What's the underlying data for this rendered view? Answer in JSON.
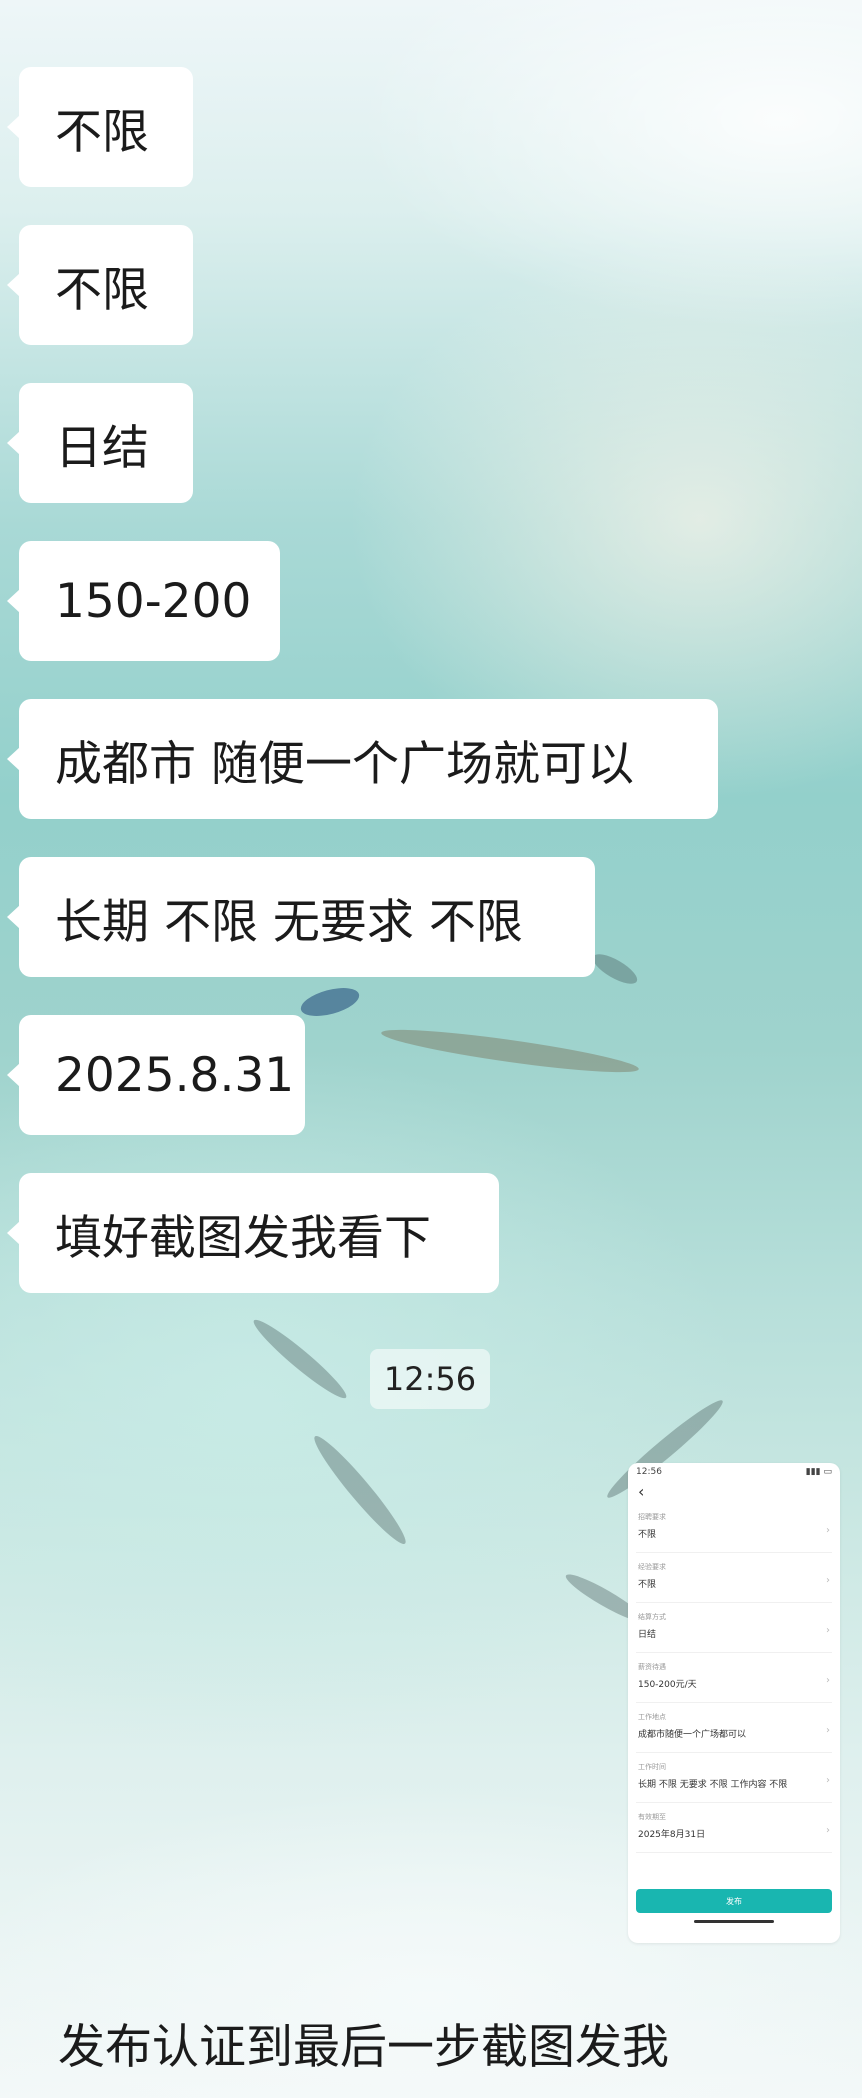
{
  "messages": [
    "不限",
    "不限",
    "日结",
    "150-200",
    "成都市 随便一个广场就可以",
    "长期 不限 无要求 不限",
    "2025.8.31",
    "填好截图发我看下"
  ],
  "timestamp": "12:56",
  "thumbnail": {
    "status_time": "12:56",
    "back_icon": "chevron-left-icon",
    "fields": [
      {
        "label": "招聘要求",
        "value": "不限"
      },
      {
        "label": "经验要求",
        "value": "不限"
      },
      {
        "label": "结算方式",
        "value": "日结"
      },
      {
        "label": "薪资待遇",
        "value": "150-200元/天"
      },
      {
        "label": "工作地点",
        "value": "成都市随便一个广场都可以"
      },
      {
        "label": "工作时间",
        "value": "长期 不限 无要求 不限 工作内容 不限"
      },
      {
        "label": "有效期至",
        "value": "2025年8月31日"
      }
    ],
    "button_label": "发布"
  },
  "footer_message": "发布认证到最后一步截图发我",
  "colors": {
    "bubble": "#ffffff",
    "text": "#1b1b1b",
    "accent": "#19b6b0"
  }
}
